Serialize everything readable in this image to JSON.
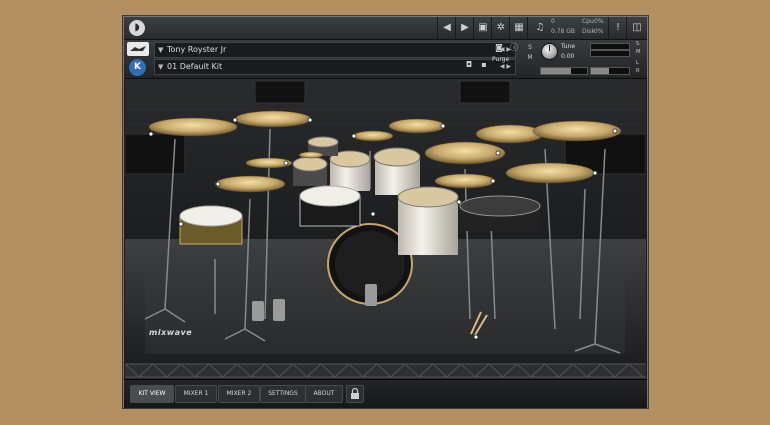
{
  "host": {
    "stats": {
      "midi": "0",
      "ram": "0.78 GB",
      "cpu_label": "Cpu",
      "cpu_value": "0%",
      "disk_label": "Disk",
      "disk_value": "0%"
    }
  },
  "instrument": {
    "name": "Tony Royster Jr",
    "kit": "01 Default Kit",
    "purge_label": "Purge",
    "tune_label": "Tune",
    "tune_value": "0.00",
    "tune_side_labels": [
      "S",
      "M",
      "L",
      "R"
    ]
  },
  "brand": {
    "logo_text": "mixwave"
  },
  "tabs": [
    {
      "label": "KIT VIEW",
      "active": true
    },
    {
      "label": "MIXER 1",
      "active": false
    },
    {
      "label": "MIXER 2",
      "active": false
    },
    {
      "label": "SETTINGS",
      "active": false
    },
    {
      "label": "ABOUT",
      "active": false
    }
  ],
  "colors": {
    "page_bg": "#b38e60",
    "window_bg": "#1b1c1e",
    "accent_blue": "#2e6fb5",
    "cymbal_gold": "#c7a86a",
    "drum_white": "#ece9e2"
  }
}
